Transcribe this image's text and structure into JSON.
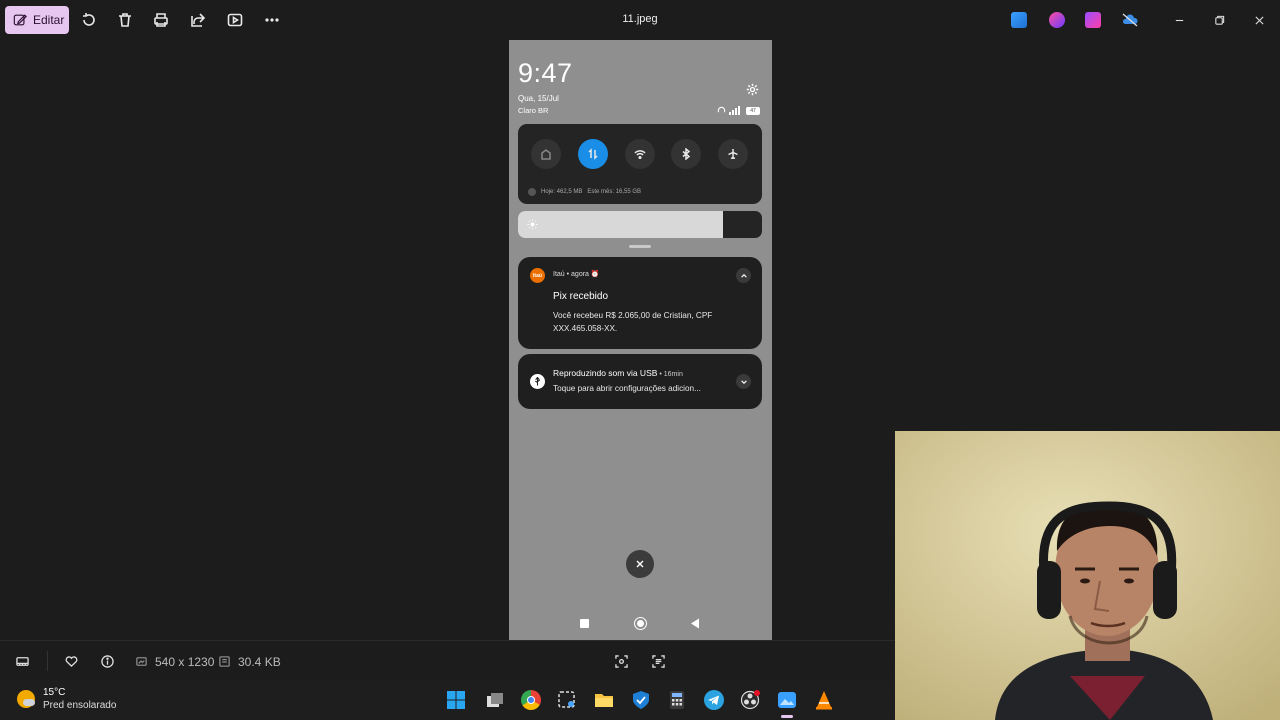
{
  "toolbar": {
    "edit_label": "Editar",
    "file_name": "11.jpeg"
  },
  "phone": {
    "time": "9:47",
    "date": "Qua, 15/Jul",
    "carrier": "Claro BR",
    "battery": "47",
    "data_today": "Hoje: 462,5 MB",
    "data_month": "Este mês: 16,55 GB",
    "brightness_level": 0.84,
    "notifications": [
      {
        "app": "Itaú",
        "time": "agora",
        "title": "Pix recebido",
        "body": "Você recebeu R$ 2.065,00 de Cristian, CPF XXX.465.058-XX."
      },
      {
        "title": "Reproduzindo som via USB",
        "time": "16min",
        "body": "Toque para abrir configurações adicion..."
      }
    ]
  },
  "infobar": {
    "dimensions": "540 x 1230",
    "file_size": "30.4 KB"
  },
  "taskbar": {
    "temperature": "15°C",
    "forecast": "Pred ensolarado"
  },
  "colors": {
    "accent": "#e7c6ef",
    "toggle_active": "#1a8ee6",
    "itau_orange": "#ec7000"
  }
}
